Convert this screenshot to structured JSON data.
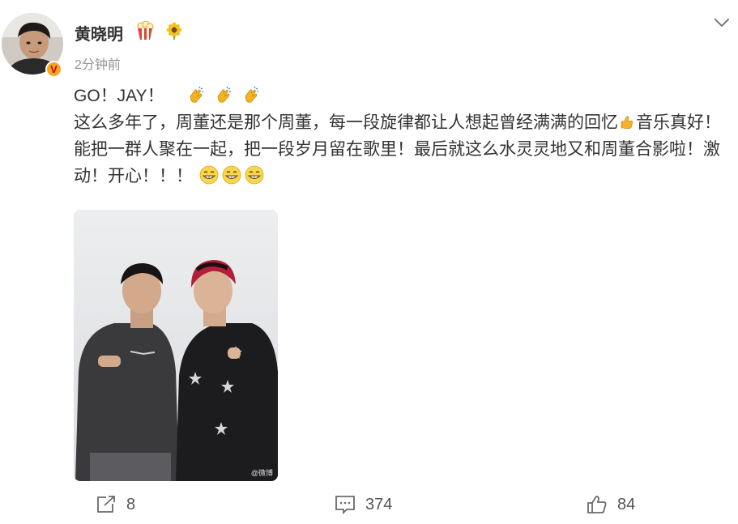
{
  "post": {
    "username": "黄晓明",
    "timestamp": "2分钟前",
    "verified_badge": "V",
    "icons": [
      "verified-v-icon",
      "popcorn-badge-icon",
      "sunflower-badge-icon",
      "chevron-down-icon"
    ],
    "text": {
      "line1": "GO！JAY！",
      "line2a": "这么多年了，周董还是那个周董，每一段旋律都让人想起曾经满满的回忆",
      "line2b": "音乐真好！能把一群人聚在一起，把一段岁月留在歌里！最后就这么水灵灵地又和周董合影啦！激动！开心！！！"
    },
    "emojis": [
      "clap-emoji",
      "thumbs-up-emoji",
      "grin-emoji"
    ],
    "photo": {
      "description_icon": "photo",
      "watermark": "@微博"
    }
  },
  "actions": {
    "repost": {
      "count": "8",
      "icon": "repost-icon"
    },
    "comment": {
      "count": "374",
      "icon": "comment-icon"
    },
    "like": {
      "count": "84",
      "icon": "thumbs-up-icon"
    }
  },
  "colors": {
    "text": "#333333",
    "meta": "#939393",
    "badge_bg": "#f5a623",
    "badge_v": "#d80000"
  }
}
